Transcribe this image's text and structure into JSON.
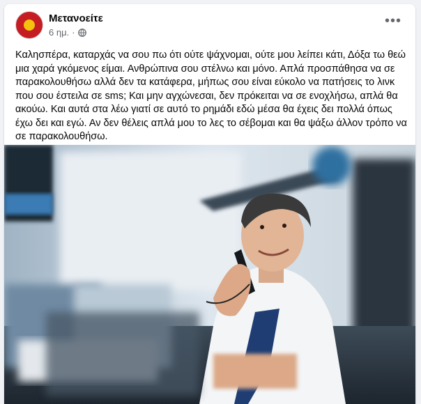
{
  "post": {
    "page_name": "Μετανοείτε",
    "time": "6 ημ.",
    "separator": "·",
    "privacy_icon": "globe-icon",
    "more_icon": "more-options-icon",
    "more_label": "•••",
    "text": "Καλησπέρα, καταρχάς να σου πω ότι ούτε ψάχνομαι, ούτε μου λείπει κάτι, Δόξα τω θεώ μια χαρά γκόμενος είμαι. Ανθρώπινα σου στέλνω και μόνο. Απλά προσπάθησα να σε παρακολουθήσω αλλά δεν τα κατάφερα, μήπως σου είναι εύκολο να πατήσεις το λινκ που σου έστειλα σε sms; Και μην αγχώνεσαι, δεν πρόκειται να σε ενοχλήσω, απλά θα ακούω. Και αυτά στα λέω γιατί σε αυτό το ρημάδι εδώ μέσα θα έχεις δει πολλά όπως έχω δει και εγώ. Αν δεν θέλεις απλά μου το λες το σέβομαι και θα ψάξω άλλον τρόπο να σε παρακολουθήσω."
  },
  "colors": {
    "avatar_red": "#c61d23",
    "avatar_yellow": "#f4c20d",
    "text": "#050505",
    "secondary_text": "#65676b",
    "background": "#f0f2f5"
  }
}
